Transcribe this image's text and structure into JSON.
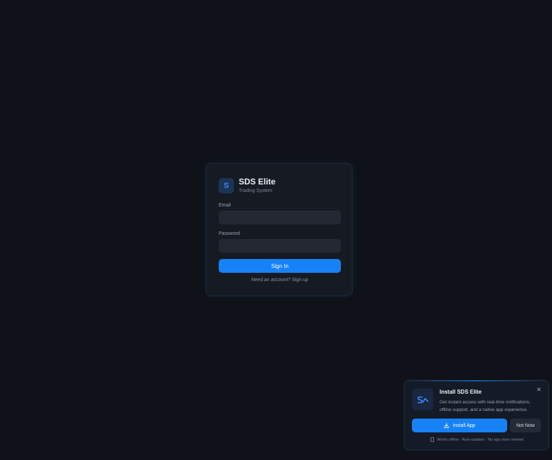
{
  "login": {
    "logo_letter": "S",
    "title": "SDS Elite",
    "subtitle": "Trading System",
    "email_label": "Email",
    "email_value": "",
    "password_label": "Password",
    "password_value": "",
    "signin_label": "Sign In",
    "signup_text": "Need an account? Sign up"
  },
  "install_prompt": {
    "title": "Install SDS Elite",
    "description": "Get instant access with real-time notifications, offline support, and a native app experience.",
    "install_label": "Install App",
    "dismiss_label": "Not Now",
    "close_symbol": "✕",
    "footnote": "Works offline · Auto-updates · No app store needed"
  },
  "colors": {
    "background": "#0f1218",
    "card": "#161a22",
    "accent": "#1782f6"
  },
  "icons": {
    "app": "sds-logo-icon",
    "download": "download-icon",
    "device": "phone-icon",
    "close": "close-icon"
  }
}
